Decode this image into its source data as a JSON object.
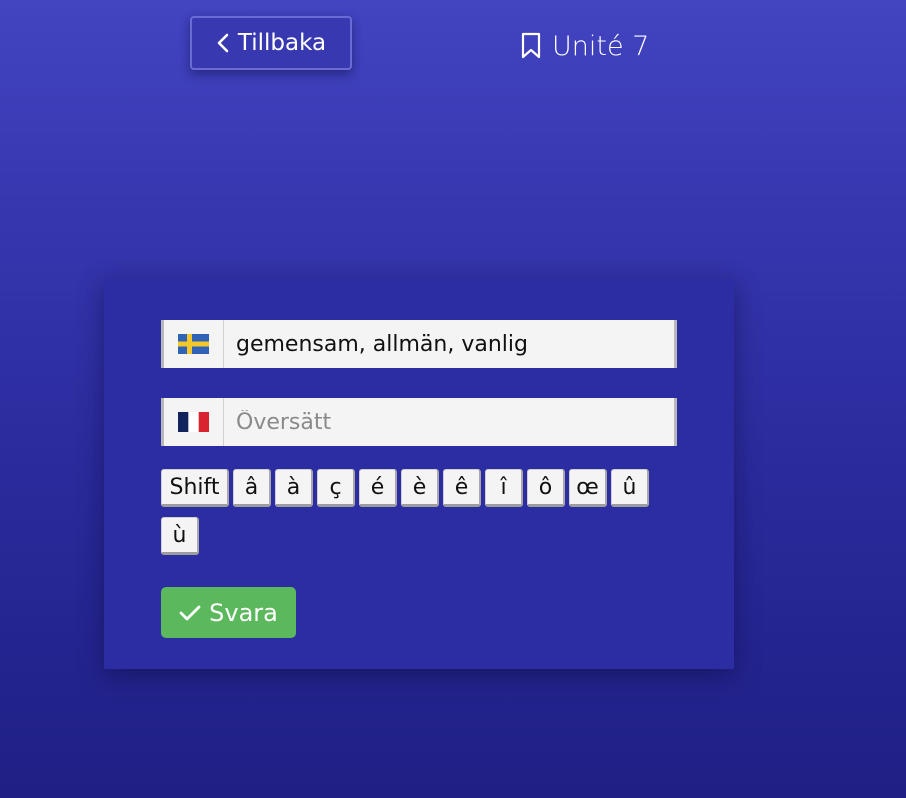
{
  "header": {
    "back_label": "Tillbaka",
    "unit_title": "Unité 7"
  },
  "card": {
    "source": {
      "flag": "sweden-flag",
      "text": "gemensam, allmän, vanlig"
    },
    "target": {
      "flag": "france-flag",
      "value": "",
      "placeholder": "Översätt"
    },
    "keys": [
      "Shift",
      "â",
      "à",
      "ç",
      "é",
      "è",
      "ê",
      "î",
      "ô",
      "œ",
      "û",
      "ù"
    ],
    "answer_label": "Svara"
  },
  "colors": {
    "background_top": "#4244c0",
    "background_bottom": "#1f1f85",
    "card": "#2c2ca3",
    "answer_button": "#5cb85c"
  }
}
